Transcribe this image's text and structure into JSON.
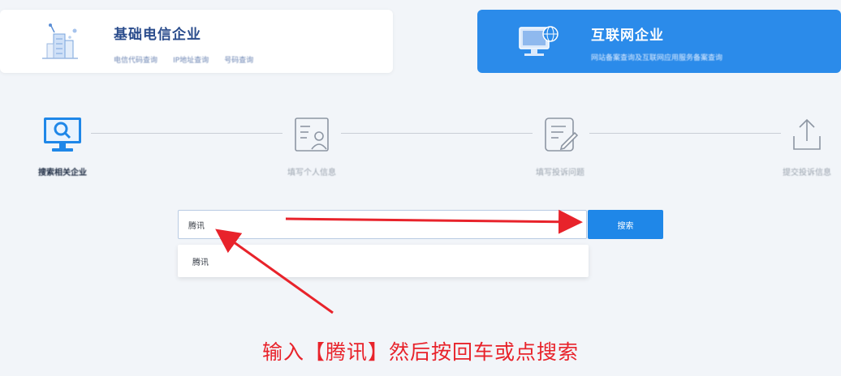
{
  "cards": {
    "basic": {
      "title": "基础电信企业",
      "tags": [
        "电信代码查询",
        "IP地址查询",
        "号码查询"
      ]
    },
    "internet": {
      "title": "互联网企业",
      "description": "网站备案查询及互联网应用服务备案查询",
      "background": "#2b8bea"
    }
  },
  "steps": [
    {
      "label": "搜索相关企业",
      "icon": "search-monitor-icon",
      "active": true
    },
    {
      "label": "填写个人信息",
      "icon": "person-form-icon",
      "active": false
    },
    {
      "label": "填写投诉问题",
      "icon": "edit-document-icon",
      "active": false
    },
    {
      "label": "提交投诉信息",
      "icon": "upload-icon",
      "active": false
    }
  ],
  "search": {
    "value": "腾讯",
    "button_label": "搜索",
    "suggestions": [
      "腾讯"
    ]
  },
  "annotation": {
    "text": "输入【腾讯】然后按回车或点搜索",
    "color": "#e8232b"
  },
  "colors": {
    "accent": "#1f87e8",
    "page_background": "#f2f5f9"
  }
}
